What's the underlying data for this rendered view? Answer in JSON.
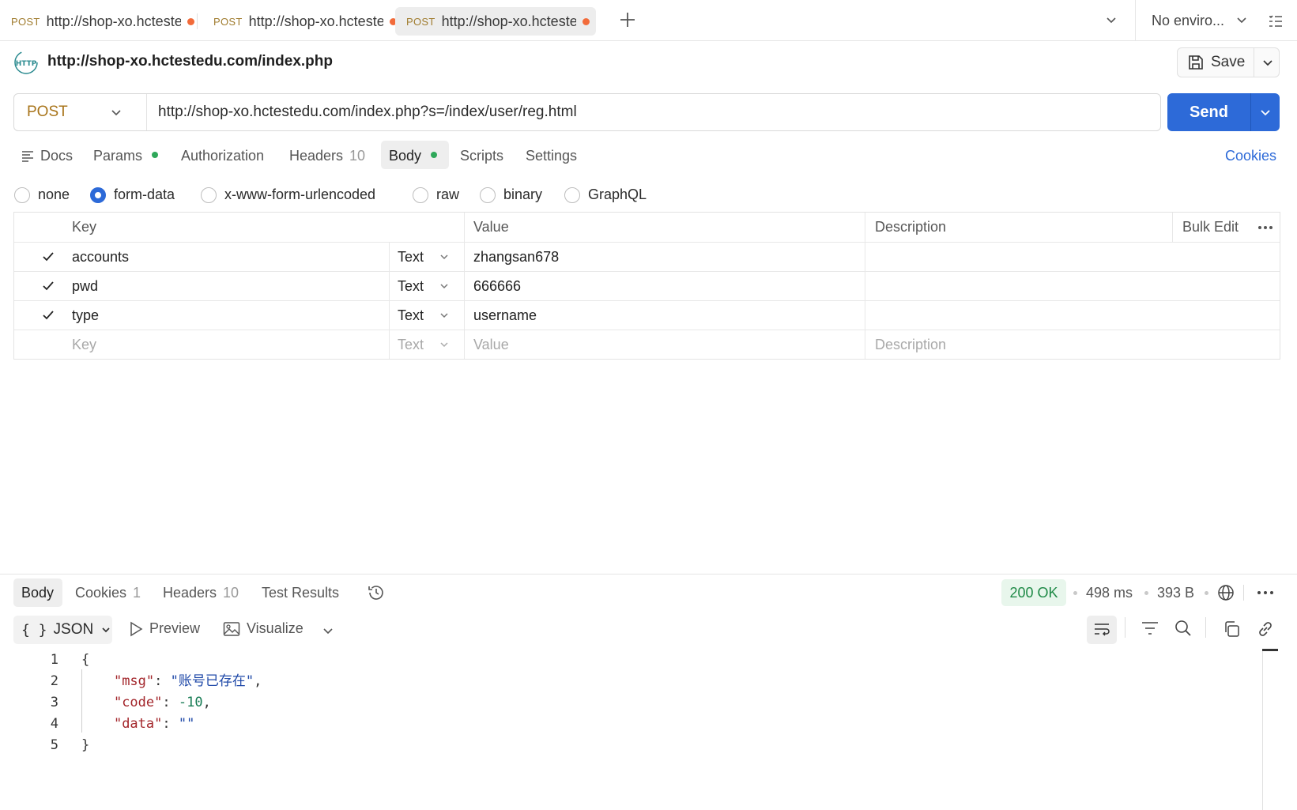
{
  "tabs": [
    {
      "method": "POST",
      "url": "http://shop-xo.hctestedu.com/index.php?s=/index/user/reg.html",
      "active": false
    },
    {
      "method": "POST",
      "url": "http://shop-xo.hctestedu.com/index.php?s=/index/user/reg.html",
      "active": false
    },
    {
      "method": "POST",
      "url": "http://shop-xo.hctestedu.com/index.php?s=/index/user/reg.html",
      "active": true
    }
  ],
  "environment": "No enviro...",
  "request": {
    "title": "http://shop-xo.hctestedu.com/index.php",
    "save_label": "Save",
    "method": "POST",
    "url": "http://shop-xo.hctestedu.com/index.php?s=/index/user/reg.html",
    "send_label": "Send"
  },
  "request_tabs": {
    "docs": "Docs",
    "params": "Params",
    "authorization": "Authorization",
    "headers": "Headers",
    "headers_count": "10",
    "body": "Body",
    "scripts": "Scripts",
    "settings": "Settings",
    "cookies": "Cookies"
  },
  "body_types": {
    "none": "none",
    "form_data": "form-data",
    "urlencoded": "x-www-form-urlencoded",
    "raw": "raw",
    "binary": "binary",
    "graphql": "GraphQL",
    "selected": "form-data"
  },
  "table": {
    "headers": {
      "key": "Key",
      "value": "Value",
      "description": "Description",
      "bulk_edit": "Bulk Edit"
    },
    "rows": [
      {
        "checked": true,
        "key": "accounts",
        "type": "Text",
        "value": "zhangsan678",
        "description": ""
      },
      {
        "checked": true,
        "key": "pwd",
        "type": "Text",
        "value": "666666",
        "description": ""
      },
      {
        "checked": true,
        "key": "type",
        "type": "Text",
        "value": "username",
        "description": ""
      }
    ],
    "placeholder": {
      "key": "Key",
      "type": "Text",
      "value": "Value",
      "description": "Description"
    }
  },
  "response": {
    "tabs": {
      "body": "Body",
      "cookies": "Cookies",
      "cookies_count": "1",
      "headers": "Headers",
      "headers_count": "10",
      "test_results": "Test Results"
    },
    "status": "200 OK",
    "time": "498 ms",
    "size": "393 B",
    "format": "JSON",
    "preview": "Preview",
    "visualize": "Visualize",
    "line_numbers": [
      "1",
      "2",
      "3",
      "4",
      "5"
    ],
    "json": {
      "open": "{",
      "msg_key": "\"msg\"",
      "msg_value": "\"账号已存在\"",
      "code_key": "\"code\"",
      "code_value": "-10",
      "data_key": "\"data\"",
      "data_value": "\"\"",
      "close": "}"
    }
  },
  "colors": {
    "accent": "#2d6ad8",
    "method": "#a8741a",
    "status_ok": "#1f8a47",
    "unsaved_dot": "#f26b3a"
  }
}
